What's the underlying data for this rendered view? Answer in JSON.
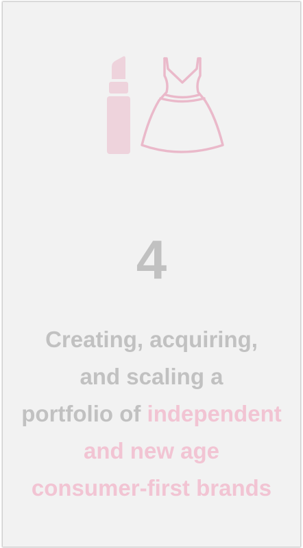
{
  "card": {
    "number": "4",
    "description": {
      "line1": "Creating, acquiring,",
      "line2": "and scaling a",
      "line3_plain": "portfolio of ",
      "line3_highlight": "independent",
      "line4": "and new age",
      "line5": "consumer-first brands"
    },
    "icons": [
      "lipstick-icon",
      "dress-icon"
    ],
    "colors": {
      "background": "#f2f2f2",
      "text_gray": "#c1c1c1",
      "accent_pink": "#f2c4d3",
      "icon_pink_fill": "#eed3dc",
      "icon_pink_stroke": "#eab9ca"
    }
  }
}
